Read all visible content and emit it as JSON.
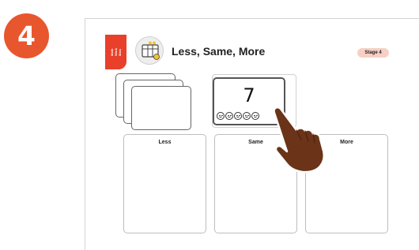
{
  "step": {
    "number": "4"
  },
  "sheet": {
    "tab_lines": [
      "Math",
      "Work",
      "Mats"
    ],
    "title": "Less, Same, More",
    "stage": "Stage 4"
  },
  "target_card": {
    "number": "7",
    "smiley_count": 5
  },
  "columns": [
    {
      "label": "Less"
    },
    {
      "label": "Same"
    },
    {
      "label": "More"
    }
  ],
  "colors": {
    "step_badge": "#e8562e",
    "tab": "#e8402a",
    "stage_badge": "#f6d0c4",
    "hand": "#6b3318",
    "icon_yellow": "#f2c230"
  },
  "icons": {
    "activity": "grid-sheet-icon",
    "hand": "pointing-hand-icon"
  }
}
